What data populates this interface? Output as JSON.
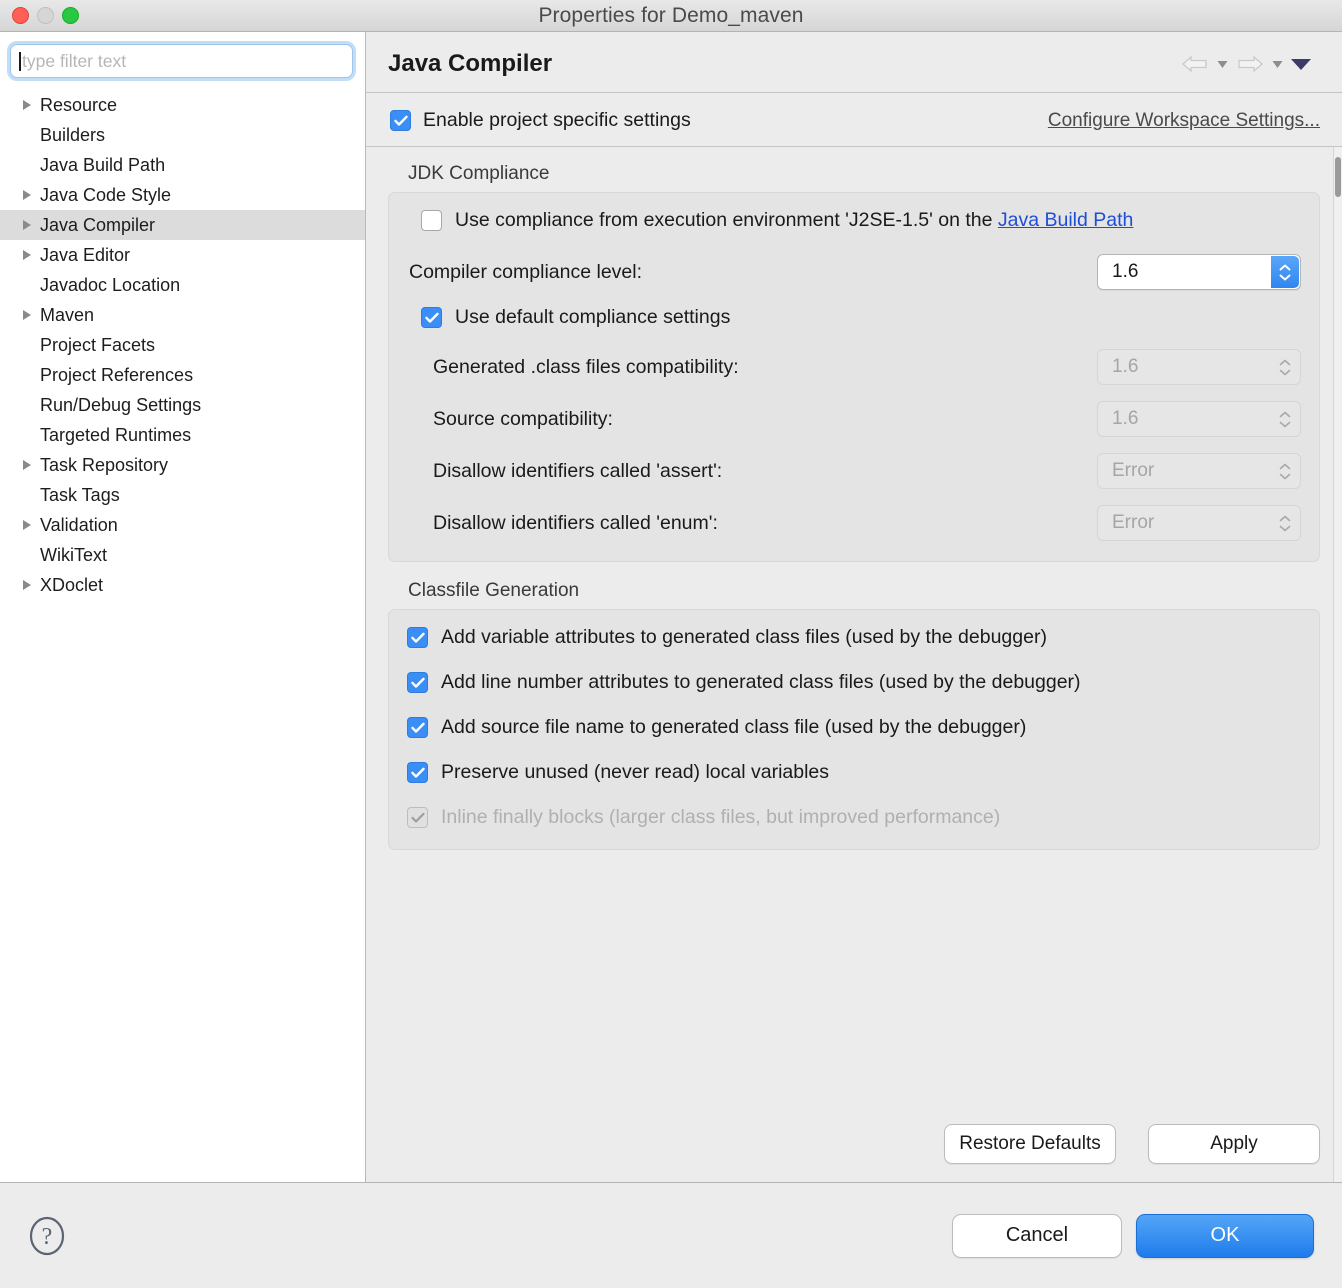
{
  "window": {
    "title": "Properties for Demo_maven",
    "traffic_lights": [
      "close",
      "minimize",
      "zoom"
    ]
  },
  "sidebar": {
    "filter": {
      "value": "",
      "placeholder": "type filter text"
    },
    "items": [
      {
        "label": "Resource",
        "expandable": true,
        "selected": false
      },
      {
        "label": "Builders",
        "expandable": false,
        "selected": false
      },
      {
        "label": "Java Build Path",
        "expandable": false,
        "selected": false
      },
      {
        "label": "Java Code Style",
        "expandable": true,
        "selected": false
      },
      {
        "label": "Java Compiler",
        "expandable": true,
        "selected": true
      },
      {
        "label": "Java Editor",
        "expandable": true,
        "selected": false
      },
      {
        "label": "Javadoc Location",
        "expandable": false,
        "selected": false
      },
      {
        "label": "Maven",
        "expandable": true,
        "selected": false
      },
      {
        "label": "Project Facets",
        "expandable": false,
        "selected": false
      },
      {
        "label": "Project References",
        "expandable": false,
        "selected": false
      },
      {
        "label": "Run/Debug Settings",
        "expandable": false,
        "selected": false
      },
      {
        "label": "Targeted Runtimes",
        "expandable": false,
        "selected": false
      },
      {
        "label": "Task Repository",
        "expandable": true,
        "selected": false
      },
      {
        "label": "Task Tags",
        "expandable": false,
        "selected": false
      },
      {
        "label": "Validation",
        "expandable": true,
        "selected": false
      },
      {
        "label": "WikiText",
        "expandable": false,
        "selected": false
      },
      {
        "label": "XDoclet",
        "expandable": true,
        "selected": false
      }
    ]
  },
  "page": {
    "title": "Java Compiler",
    "nav": {
      "back": "back-arrow",
      "forward": "forward-arrow",
      "menu": "dropdown-triangle"
    },
    "enable_project_specific": {
      "label": "Enable project specific settings",
      "checked": true
    },
    "configure_workspace_link": "Configure Workspace Settings..."
  },
  "jdk_compliance": {
    "group_label": "JDK Compliance",
    "use_execution_env": {
      "text_before": "Use compliance from execution environment 'J2SE-1.5' on the ",
      "link": "Java Build Path",
      "checked": false
    },
    "compliance_level": {
      "label": "Compiler compliance level:",
      "value": "1.6",
      "enabled": true
    },
    "use_default": {
      "label": "Use default compliance settings",
      "checked": true
    },
    "fields": [
      {
        "label": "Generated .class files compatibility:",
        "value": "1.6",
        "enabled": false
      },
      {
        "label": "Source compatibility:",
        "value": "1.6",
        "enabled": false
      },
      {
        "label": "Disallow identifiers called 'assert':",
        "value": "Error",
        "enabled": false
      },
      {
        "label": "Disallow identifiers called 'enum':",
        "value": "Error",
        "enabled": false
      }
    ]
  },
  "classfile_generation": {
    "group_label": "Classfile Generation",
    "options": [
      {
        "label": "Add variable attributes to generated class files (used by the debugger)",
        "checked": true,
        "enabled": true
      },
      {
        "label": "Add line number attributes to generated class files (used by the debugger)",
        "checked": true,
        "enabled": true
      },
      {
        "label": "Add source file name to generated class file (used by the debugger)",
        "checked": true,
        "enabled": true
      },
      {
        "label": "Preserve unused (never read) local variables",
        "checked": true,
        "enabled": true
      },
      {
        "label": "Inline finally blocks (larger class files, but improved performance)",
        "checked": true,
        "enabled": false
      }
    ]
  },
  "page_actions": {
    "restore_defaults": "Restore Defaults",
    "apply": "Apply"
  },
  "footer": {
    "help": "?",
    "cancel": "Cancel",
    "ok": "OK"
  },
  "colors": {
    "accent_blue": "#3a8ef6",
    "ok_button_blue": "#1f7ceb",
    "link_blue": "#1d4ed8",
    "window_bg": "#ececec",
    "selection_gray": "#dcdcdc"
  }
}
